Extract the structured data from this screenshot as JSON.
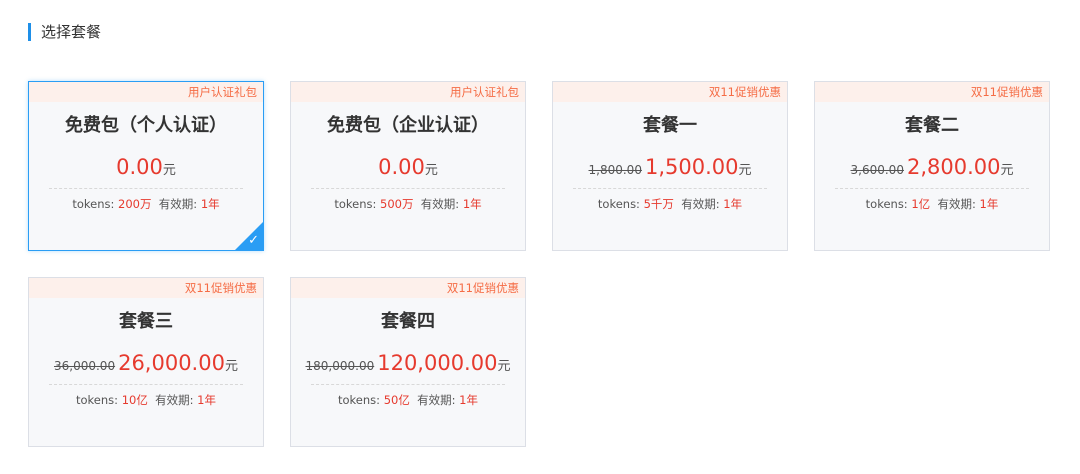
{
  "section": {
    "title": "选择套餐"
  },
  "packages": [
    {
      "tag": "用户认证礼包",
      "name": "免费包（个人认证）",
      "original_price": "",
      "price": "0.00",
      "unit": "元",
      "tokens_label": "tokens:",
      "tokens": "200万",
      "validity_label": "有效期:",
      "validity": "1年",
      "selected": true
    },
    {
      "tag": "用户认证礼包",
      "name": "免费包（企业认证）",
      "original_price": "",
      "price": "0.00",
      "unit": "元",
      "tokens_label": "tokens:",
      "tokens": "500万",
      "validity_label": "有效期:",
      "validity": "1年",
      "selected": false
    },
    {
      "tag": "双11促销优惠",
      "name": "套餐一",
      "original_price": "1,800.00",
      "price": "1,500.00",
      "unit": "元",
      "tokens_label": "tokens:",
      "tokens": "5千万",
      "validity_label": "有效期:",
      "validity": "1年",
      "selected": false
    },
    {
      "tag": "双11促销优惠",
      "name": "套餐二",
      "original_price": "3,600.00",
      "price": "2,800.00",
      "unit": "元",
      "tokens_label": "tokens:",
      "tokens": "1亿",
      "validity_label": "有效期:",
      "validity": "1年",
      "selected": false
    },
    {
      "tag": "双11促销优惠",
      "name": "套餐三",
      "original_price": "36,000.00",
      "price": "26,000.00",
      "unit": "元",
      "tokens_label": "tokens:",
      "tokens": "10亿",
      "validity_label": "有效期:",
      "validity": "1年",
      "selected": false
    },
    {
      "tag": "双11促销优惠",
      "name": "套餐四",
      "original_price": "180,000.00",
      "price": "120,000.00",
      "unit": "元",
      "tokens_label": "tokens:",
      "tokens": "50亿",
      "validity_label": "有效期:",
      "validity": "1年",
      "selected": false
    }
  ],
  "selected_indicator": {
    "icon": "checkmark-icon",
    "glyph": "✓",
    "color": "#2a9df4"
  }
}
